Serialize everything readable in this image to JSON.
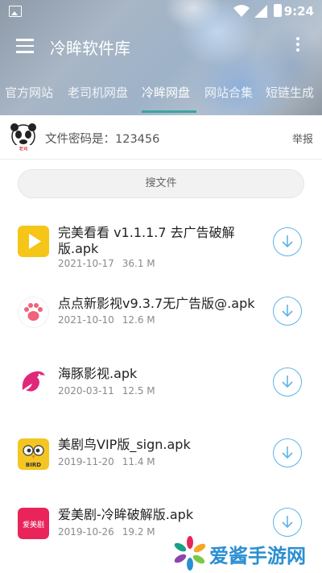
{
  "status_bar": {
    "time": "9:24"
  },
  "app": {
    "title": "冷眸软件库"
  },
  "tabs": [
    {
      "label": "官方网站"
    },
    {
      "label": "老司机网盘"
    },
    {
      "label": "冷眸网盘",
      "active": true
    },
    {
      "label": "网站合集"
    },
    {
      "label": "短链生成"
    }
  ],
  "password_bar": {
    "text": "文件密码是：123456",
    "report_label": "举报"
  },
  "search": {
    "placeholder": "搜文件"
  },
  "files": [
    {
      "name": "完美看看 v1.1.1.7 去广告破解版.apk",
      "date": "2021-10-17",
      "size": "36.1 M",
      "icon": "play-icon",
      "icon_color": "#f5c518"
    },
    {
      "name": "点点新影视v9.3.7无广告版@.apk",
      "date": "2021-10-10",
      "size": "12.6 M",
      "icon": "paw-icon",
      "icon_color": "#f0637a"
    },
    {
      "name": "海豚影视.apk",
      "date": "2020-03-11",
      "size": "12.5 M",
      "icon": "dolphin-icon",
      "icon_color": "#e0287a"
    },
    {
      "name": "美剧鸟VIP版_sign.apk",
      "date": "2019-11-20",
      "size": "11.4 M",
      "icon": "bird-icon",
      "icon_color": "#f3c623"
    },
    {
      "name": "爱美剧-冷眸破解版.apk",
      "date": "2019-10-26",
      "size": "19.2 M",
      "icon": "aimeiju-icon",
      "icon_color": "#e8245a",
      "icon_text": "爱美剧"
    }
  ],
  "watermark": {
    "text": "爱酱手游网"
  },
  "colors": {
    "accent": "#3aa6a0",
    "download": "#5fb4e6"
  }
}
